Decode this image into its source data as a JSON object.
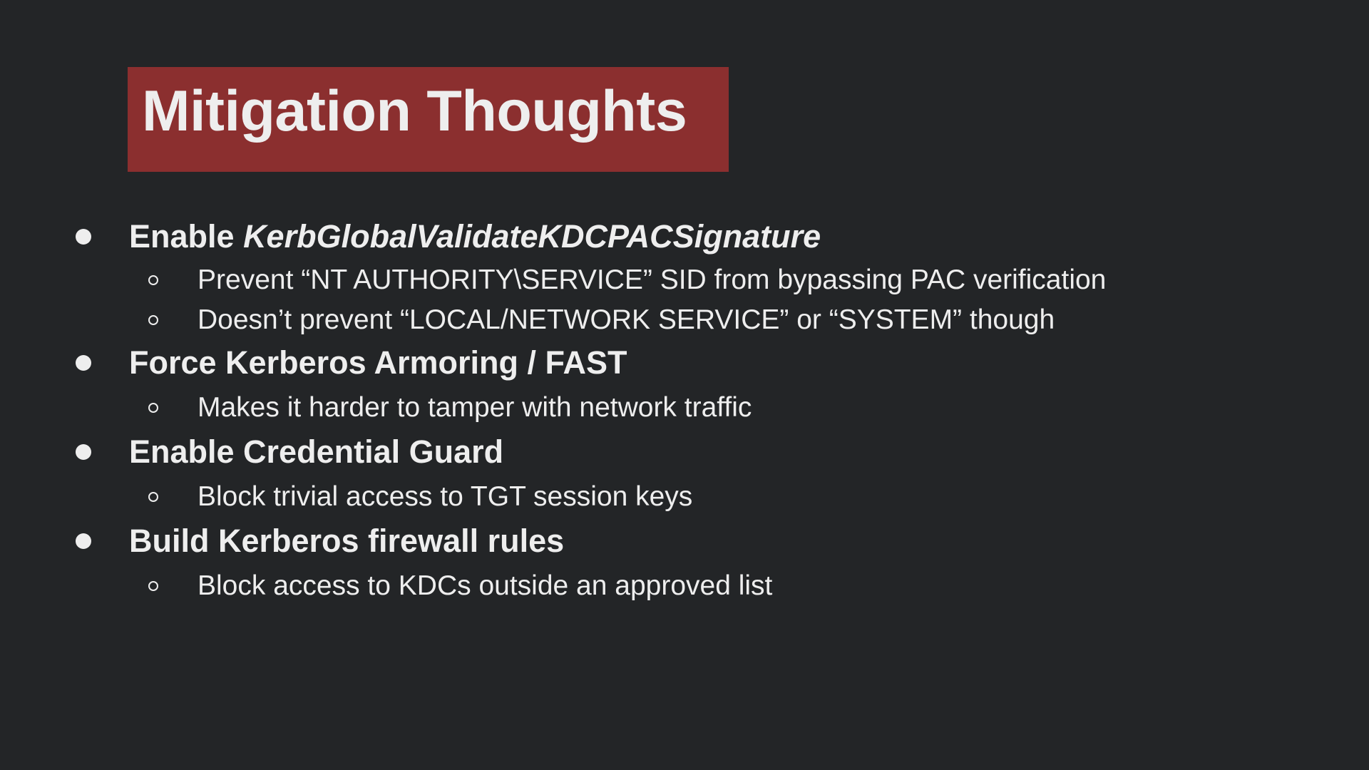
{
  "slide": {
    "title": "Mitigation Thoughts",
    "bullets": [
      {
        "label_prefix": "Enable ",
        "label_italic": "KerbGlobalValidateKDCPACSignature",
        "subitems": [
          "Prevent “NT AUTHORITY\\SERVICE” SID from bypassing PAC verification",
          "Doesn’t prevent “LOCAL/NETWORK SERVICE” or “SYSTEM” though"
        ]
      },
      {
        "label": "Force Kerberos Armoring / FAST",
        "subitems": [
          "Makes it harder to tamper with network traffic"
        ]
      },
      {
        "label": "Enable Credential Guard",
        "subitems": [
          "Block trivial access to TGT session keys"
        ]
      },
      {
        "label": "Build Kerberos firewall rules",
        "subitems": [
          "Block access to KDCs outside an approved list"
        ]
      }
    ]
  },
  "colors": {
    "background": "#232527",
    "title_box": "#8b2f2f",
    "text": "#eeeeee"
  }
}
